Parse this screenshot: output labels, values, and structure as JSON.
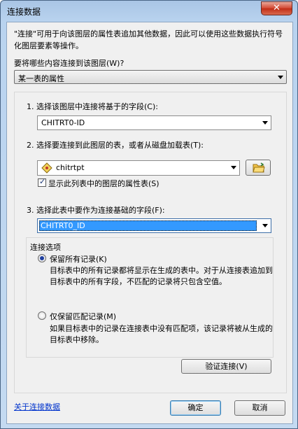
{
  "window": {
    "title": "连接数据",
    "close_glyph": "✕"
  },
  "description": "\"连接\"可用于向该图层的属性表追加其他数据，因此可以使用这些数据执行符号化图层要素等操作。",
  "join_question": "要将哪些内容连接到该图层(W)?",
  "join_type": {
    "selected": "某一表的属性"
  },
  "step1": {
    "label": "1. 选择该图层中连接将基于的字段(C):",
    "field_value": "CHITRT0-ID"
  },
  "step2": {
    "label": "2. 选择要连接到此图层的表，或者从磁盘加载表(T):",
    "table_value": "chitrtpt",
    "checkbox_label": "显示此列表中的图层的属性表(S)",
    "checkbox_checked": true
  },
  "step3": {
    "label": "3. 选择此表中要作为连接基础的字段(F):",
    "field_value": "CHITRT0_ID"
  },
  "join_options": {
    "legend": "连接选项",
    "keep_all": {
      "label": "保留所有记录(K)",
      "selected": true,
      "desc": "目标表中的所有记录都将显示在生成的表中。对于从连接表追加到目标表中的所有字段，不匹配的记录将只包含空值。"
    },
    "keep_matching": {
      "label": "仅保留匹配记录(M)",
      "selected": false,
      "desc": "如果目标表中的记录在连接表中没有匹配项，该记录将被从生成的目标表中移除。"
    }
  },
  "buttons": {
    "validate": "验证连接(V)",
    "ok": "确定",
    "cancel": "取消"
  },
  "link": {
    "about": "关于连接数据"
  },
  "icons": {
    "layer": "layer-icon",
    "folder": "open-folder-icon",
    "close": "close-icon"
  }
}
